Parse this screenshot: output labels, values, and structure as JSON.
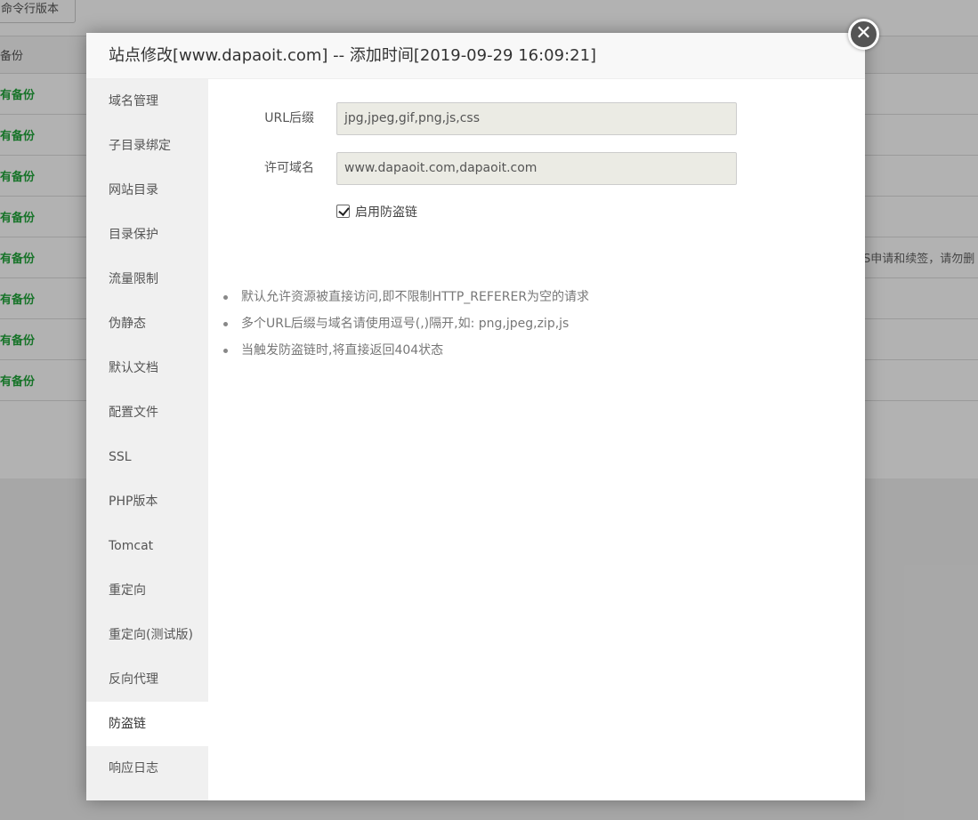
{
  "background": {
    "cmd_button": "命令行版本",
    "header_cell": "备份",
    "rows": [
      "有备份",
      "有备份",
      "有备份",
      "有备份",
      "有备份",
      "有备份",
      "有备份",
      "有备份"
    ],
    "right_text": "S申请和续签，请勿删"
  },
  "modal": {
    "title": "站点修改[www.dapaoit.com] -- 添加时间[2019-09-29 16:09:21]",
    "close_glyph": "✕",
    "sidebar": [
      "域名管理",
      "子目录绑定",
      "网站目录",
      "目录保护",
      "流量限制",
      "伪静态",
      "默认文档",
      "配置文件",
      "SSL",
      "PHP版本",
      "Tomcat",
      "重定向",
      "重定向(测试版)",
      "反向代理",
      "防盗链",
      "响应日志"
    ],
    "active_index": 14,
    "form": {
      "url_suffix_label": "URL后缀",
      "url_suffix_value": "jpg,jpeg,gif,png,js,css",
      "domain_label": "许可域名",
      "domain_value": "www.dapaoit.com,dapaoit.com",
      "enable_label": "启用防盗链",
      "enable_checked": true
    },
    "tips": [
      "默认允许资源被直接访问,即不限制HTTP_REFERER为空的请求",
      "多个URL后缀与域名请使用逗号(,)隔开,如: png,jpeg,zip,js",
      "当触发防盗链时,将直接返回404状态"
    ]
  }
}
